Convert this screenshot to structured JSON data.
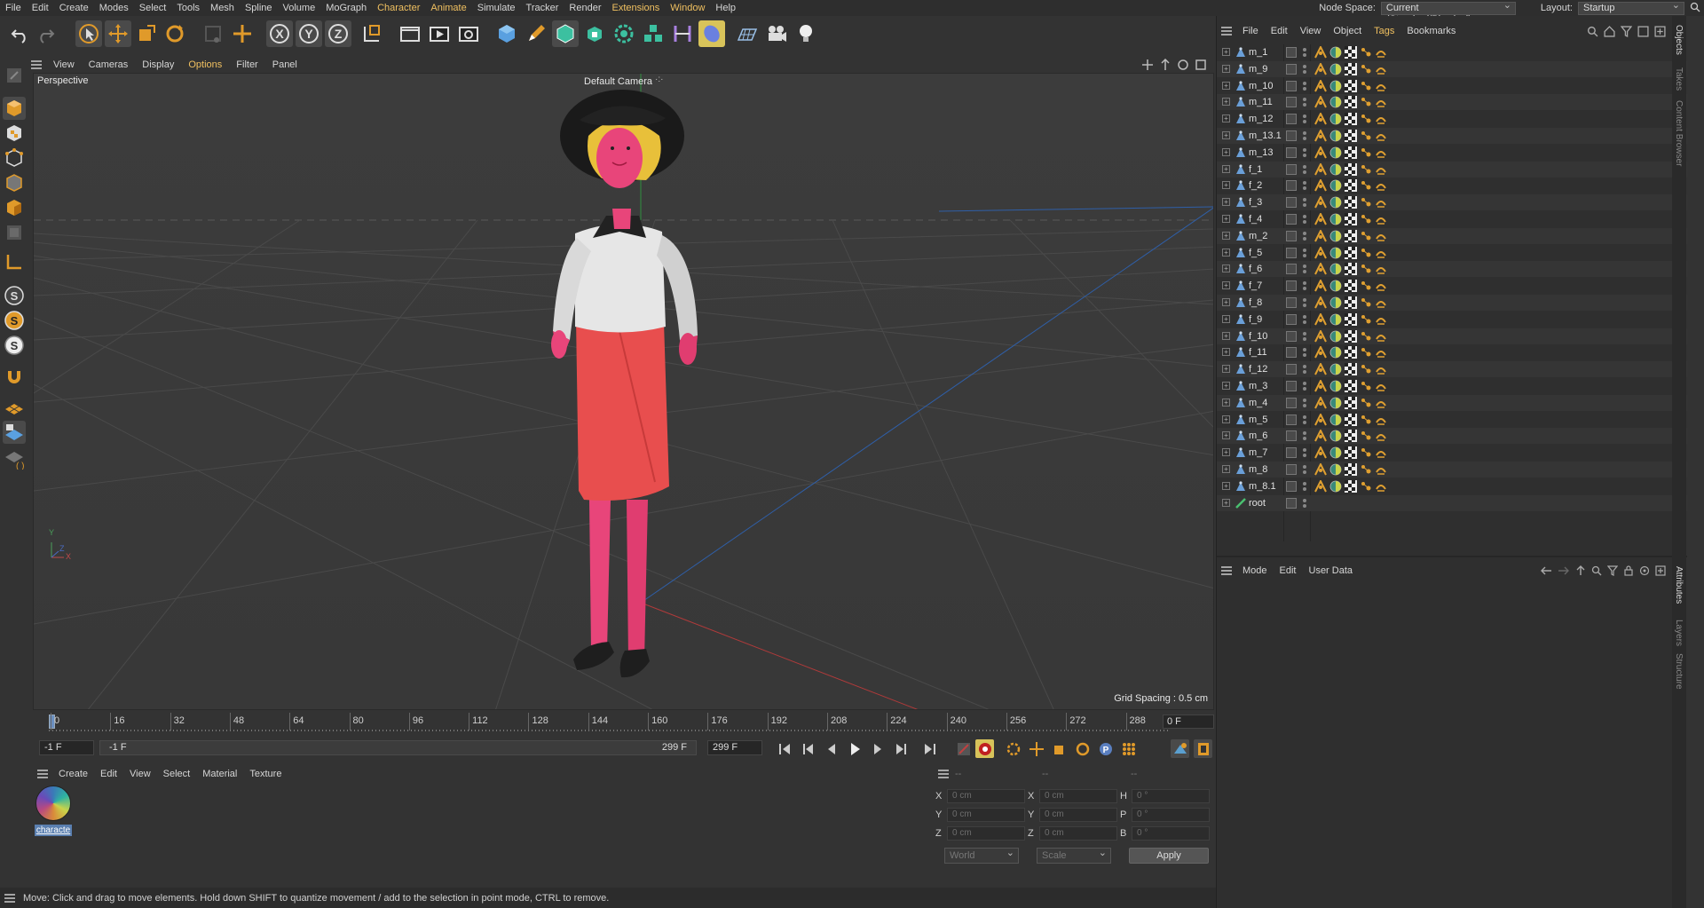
{
  "menubar": {
    "items": [
      "File",
      "Edit",
      "Create",
      "Modes",
      "Select",
      "Tools",
      "Mesh",
      "Spline",
      "Volume",
      "MoGraph",
      "Character",
      "Animate",
      "Simulate",
      "Tracker",
      "Render",
      "Extensions",
      "Window",
      "Help"
    ],
    "node_space_label": "Node Space:",
    "node_space_value": "Current (Standard/Physical)",
    "layout_label": "Layout:",
    "layout_value": "Startup"
  },
  "viewport": {
    "menu": [
      "View",
      "Cameras",
      "Display",
      "Options",
      "Filter",
      "Panel"
    ],
    "view_name": "Perspective",
    "camera": "Default Camera",
    "camera_glyph": "·:·",
    "grid_spacing": "Grid Spacing : 0.5 cm",
    "axis_y": "Y",
    "axis_x": "X",
    "axis_z": "Z"
  },
  "timeline": {
    "ticks": [
      "0",
      "16",
      "32",
      "48",
      "64",
      "80",
      "96",
      "112",
      "128",
      "144",
      "160",
      "176",
      "192",
      "208",
      "224",
      "240",
      "256",
      "272",
      "288"
    ],
    "current_frame": "0 F",
    "start_field": "-1 F",
    "range_start": "-1 F",
    "range_end": "299 F",
    "end_field": "299 F"
  },
  "materials": {
    "menu": [
      "Create",
      "Edit",
      "View",
      "Select",
      "Material",
      "Texture"
    ],
    "items": [
      {
        "name": "characte"
      }
    ]
  },
  "coordinates": {
    "headers": [
      "--",
      "--",
      "--"
    ],
    "rows": [
      {
        "a": "X",
        "av": "0 cm",
        "b": "X",
        "bv": "0 cm",
        "c": "H",
        "cv": "0 °"
      },
      {
        "a": "Y",
        "av": "0 cm",
        "b": "Y",
        "bv": "0 cm",
        "c": "P",
        "cv": "0 °"
      },
      {
        "a": "Z",
        "av": "0 cm",
        "b": "Z",
        "bv": "0 cm",
        "c": "B",
        "cv": "0 °"
      }
    ],
    "mode1": "World",
    "mode2": "Scale",
    "apply": "Apply"
  },
  "status": "Move: Click and drag to move elements. Hold down SHIFT to quantize movement / add to the selection in point mode, CTRL to remove.",
  "objects": {
    "menu": [
      "File",
      "Edit",
      "View",
      "Object",
      "Tags",
      "Bookmarks"
    ],
    "items": [
      "m_1",
      "m_9",
      "m_10",
      "m_11",
      "m_12",
      "m_13.1",
      "m_13",
      "f_1",
      "f_2",
      "f_3",
      "f_4",
      "m_2",
      "f_5",
      "f_6",
      "f_7",
      "f_8",
      "f_9",
      "f_10",
      "f_11",
      "f_12",
      "m_3",
      "m_4",
      "m_5",
      "m_6",
      "m_7",
      "m_8",
      "m_8.1",
      "root"
    ]
  },
  "attributes": {
    "menu": [
      "Mode",
      "Edit",
      "User Data"
    ]
  },
  "side_tabs": [
    "Objects",
    "Takes",
    "Content Browser",
    "Attributes",
    "Layers",
    "Structure"
  ],
  "colors": {
    "accent": "#f0c060",
    "bg": "#333333",
    "skin": "#e84a7a",
    "skirt": "#e84e4e"
  }
}
